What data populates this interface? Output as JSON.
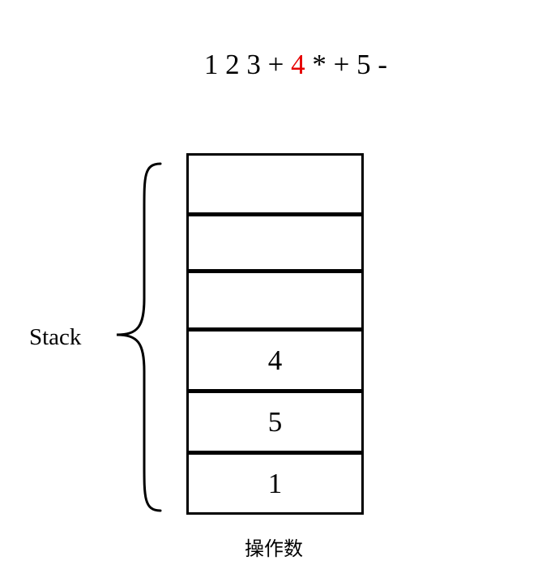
{
  "expression": {
    "tokens": [
      {
        "text": "1",
        "highlight": false
      },
      {
        "text": "2",
        "highlight": false
      },
      {
        "text": "3",
        "highlight": false
      },
      {
        "text": "+",
        "highlight": false
      },
      {
        "text": "4",
        "highlight": true
      },
      {
        "text": "*",
        "highlight": false
      },
      {
        "text": "+",
        "highlight": false
      },
      {
        "text": "5",
        "highlight": false
      },
      {
        "text": "-",
        "highlight": false
      }
    ],
    "highlight_color": "#e60000"
  },
  "stack": {
    "label": "Stack",
    "slots": [
      "",
      "",
      "",
      "4",
      "5",
      "1"
    ]
  },
  "caption": "操作数"
}
